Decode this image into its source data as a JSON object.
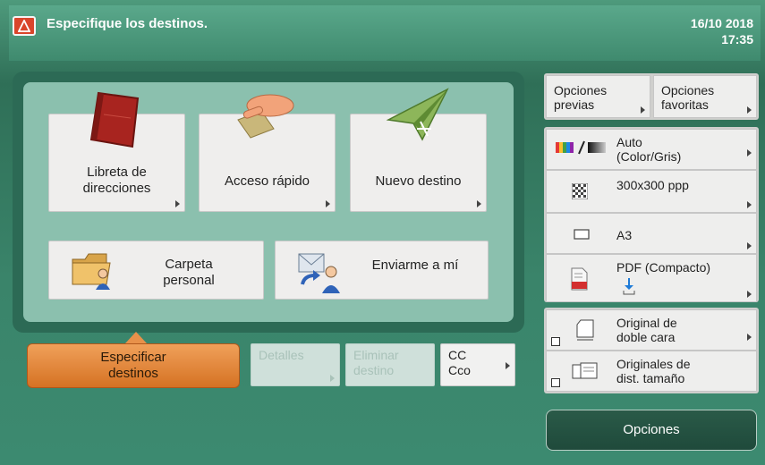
{
  "header": {
    "message": "Especifique los destinos.",
    "date": "16/10 2018",
    "time": "17:35"
  },
  "destinations": {
    "address_book": "Libreta de direcciones",
    "address_book_l1": "Libreta de",
    "address_book_l2": "direcciones",
    "quick_access": "Acceso rápido",
    "new_destination": "Nuevo destino",
    "personal_folder_l1": "Carpeta",
    "personal_folder_l2": "personal",
    "send_to_myself": "Enviarme a mí"
  },
  "bottom_bar": {
    "specify_l1": "Especificar",
    "specify_l2": "destinos",
    "details": "Detalles",
    "delete_l1": "Eliminar",
    "delete_l2": "destino",
    "cc": "CC",
    "bcc": "Cco"
  },
  "side_panel": {
    "previous_l1": "Opciones",
    "previous_l2": "previas",
    "favorites_l1": "Opciones",
    "favorites_l2": "favoritas",
    "color_l1": "Auto",
    "color_l2": "(Color/Gris)",
    "resolution": "300x300 ppp",
    "paper_size": "A3",
    "file_format": "PDF (Compacto)",
    "duplex_l1": "Original de",
    "duplex_l2": "doble cara",
    "mixed_l1": "Originales de",
    "mixed_l2": "dist. tamaño",
    "options": "Opciones"
  },
  "icons": {
    "warning": "warning-icon",
    "address_book": "address-book-icon",
    "quick_access": "hand-pointer-icon",
    "new_destination": "paper-plane-icon",
    "personal_folder": "folder-user-icon",
    "send_to_myself": "send-self-icon",
    "color_mode": "color-mode-icon",
    "resolution": "resolution-icon",
    "paper": "paper-size-icon",
    "pdf": "pdf-file-icon",
    "duplex": "duplex-original-icon",
    "mixed_sizes": "mixed-size-icon"
  },
  "colors": {
    "accent_orange": "#e08a3c",
    "panel_green": "#3a846a",
    "warning_red": "#d9452b"
  }
}
